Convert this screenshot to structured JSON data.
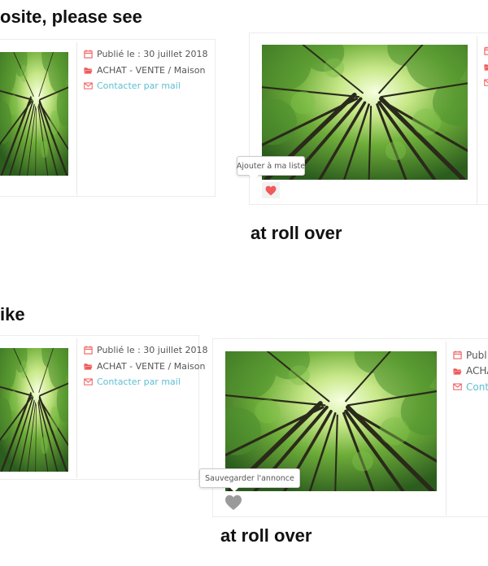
{
  "headings": {
    "top_intro": "osite, please see",
    "top_rollover": "at roll over",
    "bottom_intro": "ike",
    "bottom_rollover": "at roll over"
  },
  "listing": {
    "published": "Publié le : 30 juillet 2018",
    "category": "ACHAT - VENTE / Maison",
    "contact": "Contacter par mail"
  },
  "partial_meta": {
    "published": "Publ",
    "category": "ACHA",
    "contact": "Cont"
  },
  "tooltips": {
    "add_to_list": "Ajouter à ma liste",
    "save_ad": "Sauvegarder l'annonce"
  },
  "colors": {
    "accent_red": "#f05a5a",
    "link_teal": "#5dbfcf",
    "heart_grey": "#9a9a9a"
  },
  "icons": {
    "calendar": "calendar-icon",
    "folder": "folder-open-icon",
    "mail": "envelope-icon",
    "heart": "heart-icon"
  }
}
